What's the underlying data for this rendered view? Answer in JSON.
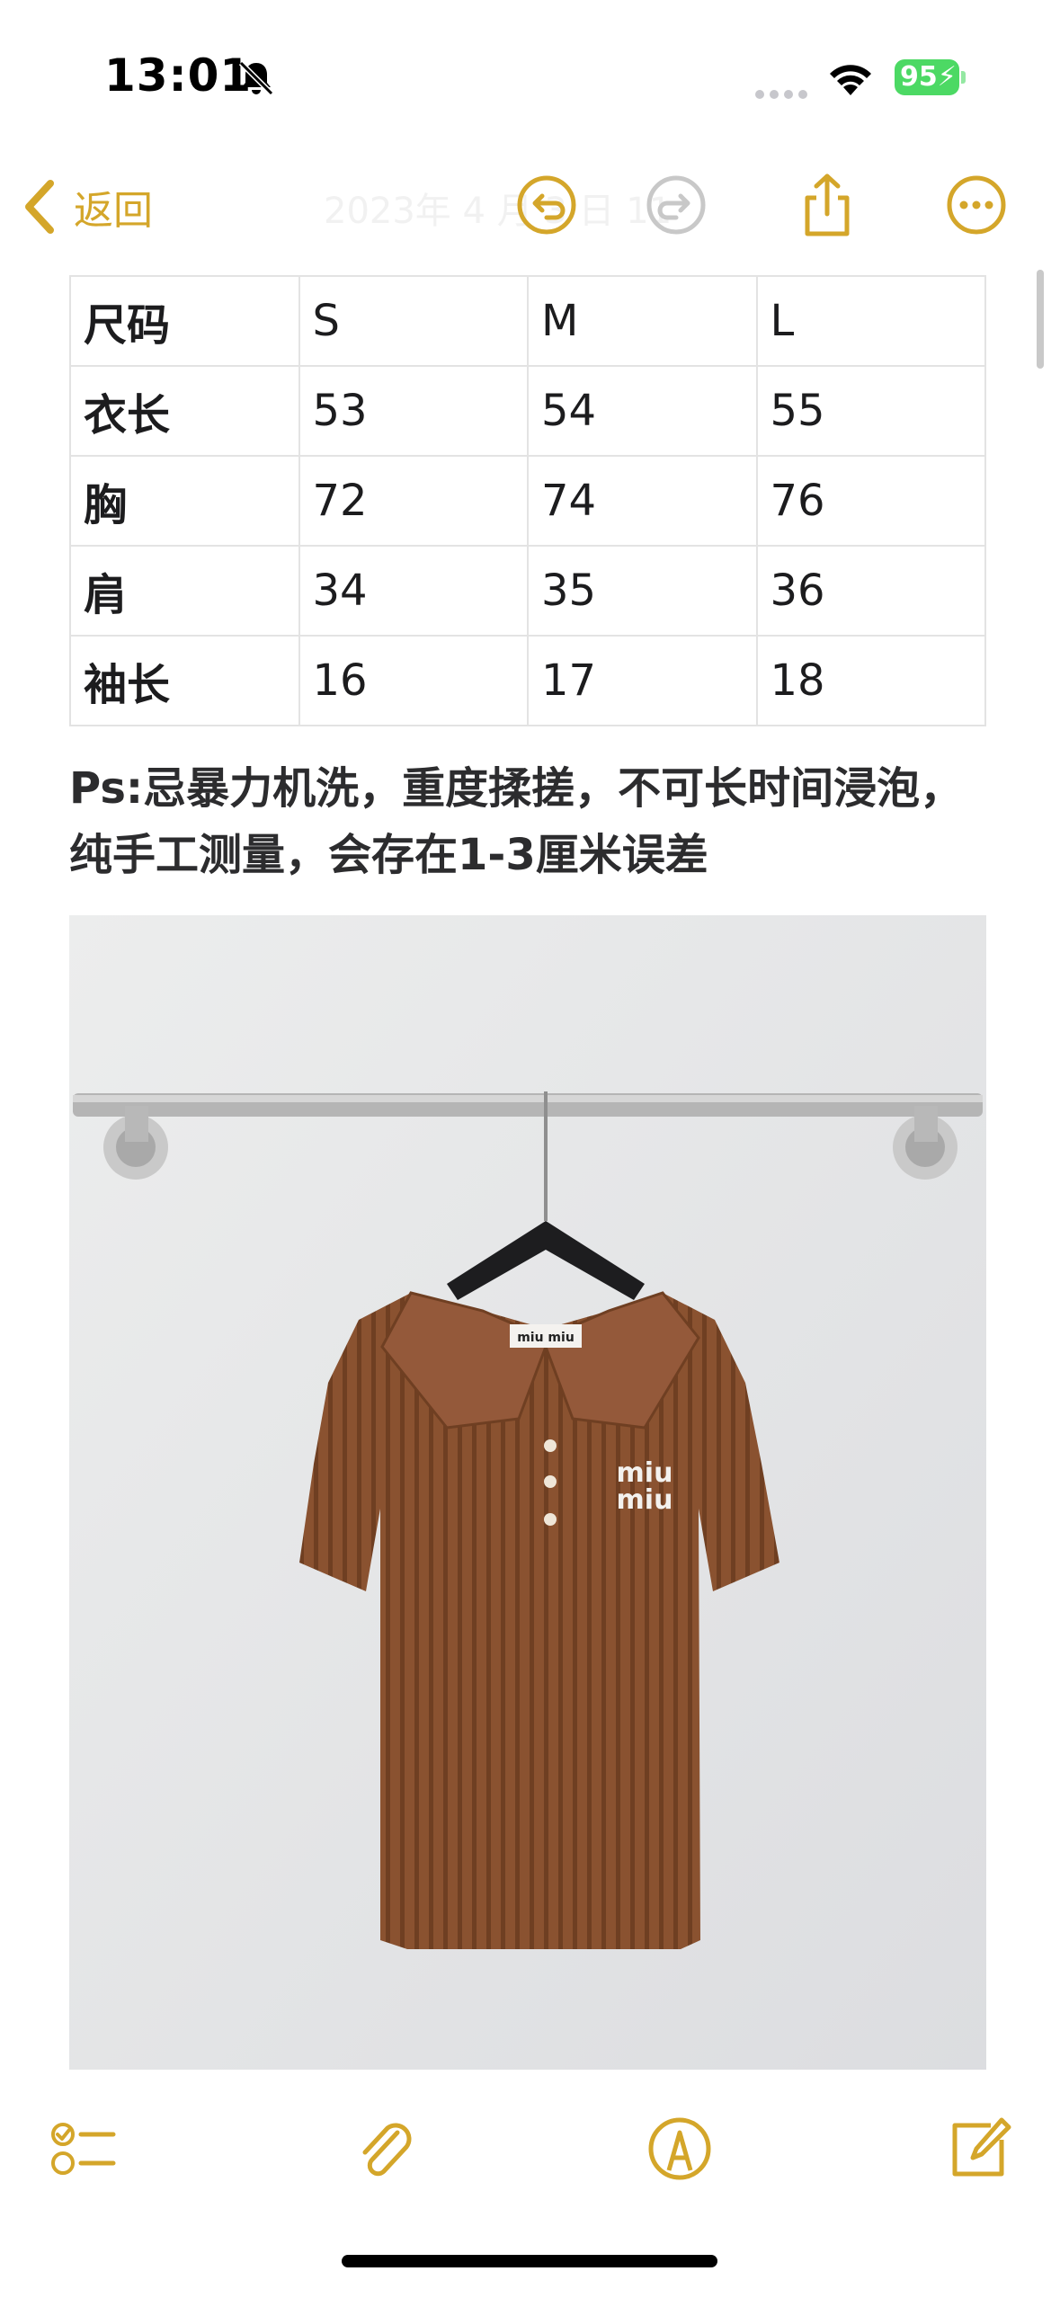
{
  "status_bar": {
    "time": "13:01",
    "battery": "95"
  },
  "toolbar": {
    "back_label": "返回",
    "faded_title": "2023年 4 月 3 日 11"
  },
  "size_table": {
    "rows": [
      [
        "尺码",
        "S",
        "M",
        "L"
      ],
      [
        "衣长",
        "53",
        "54",
        "55"
      ],
      [
        "胸",
        "72",
        "74",
        "76"
      ],
      [
        "肩",
        "34",
        "35",
        "36"
      ],
      [
        "袖长",
        "16",
        "17",
        "18"
      ]
    ]
  },
  "note": {
    "text": "Ps:忌暴力机洗，重度揉搓，不可长时间浸泡，纯手工测量，会存在1-3厘米误差"
  },
  "photo": {
    "label_text": "miu miu",
    "logo_line1": "miu",
    "logo_line2": "miu"
  },
  "colors": {
    "accent": "#d4a62a",
    "battery": "#4cd964",
    "garment": "#8a5230"
  },
  "icons": [
    "bell-slash-icon",
    "wifi-icon",
    "chevron-left-icon",
    "undo-icon",
    "redo-icon",
    "share-icon",
    "more-icon",
    "checklist-icon",
    "paperclip-icon",
    "markup-icon",
    "compose-icon"
  ]
}
